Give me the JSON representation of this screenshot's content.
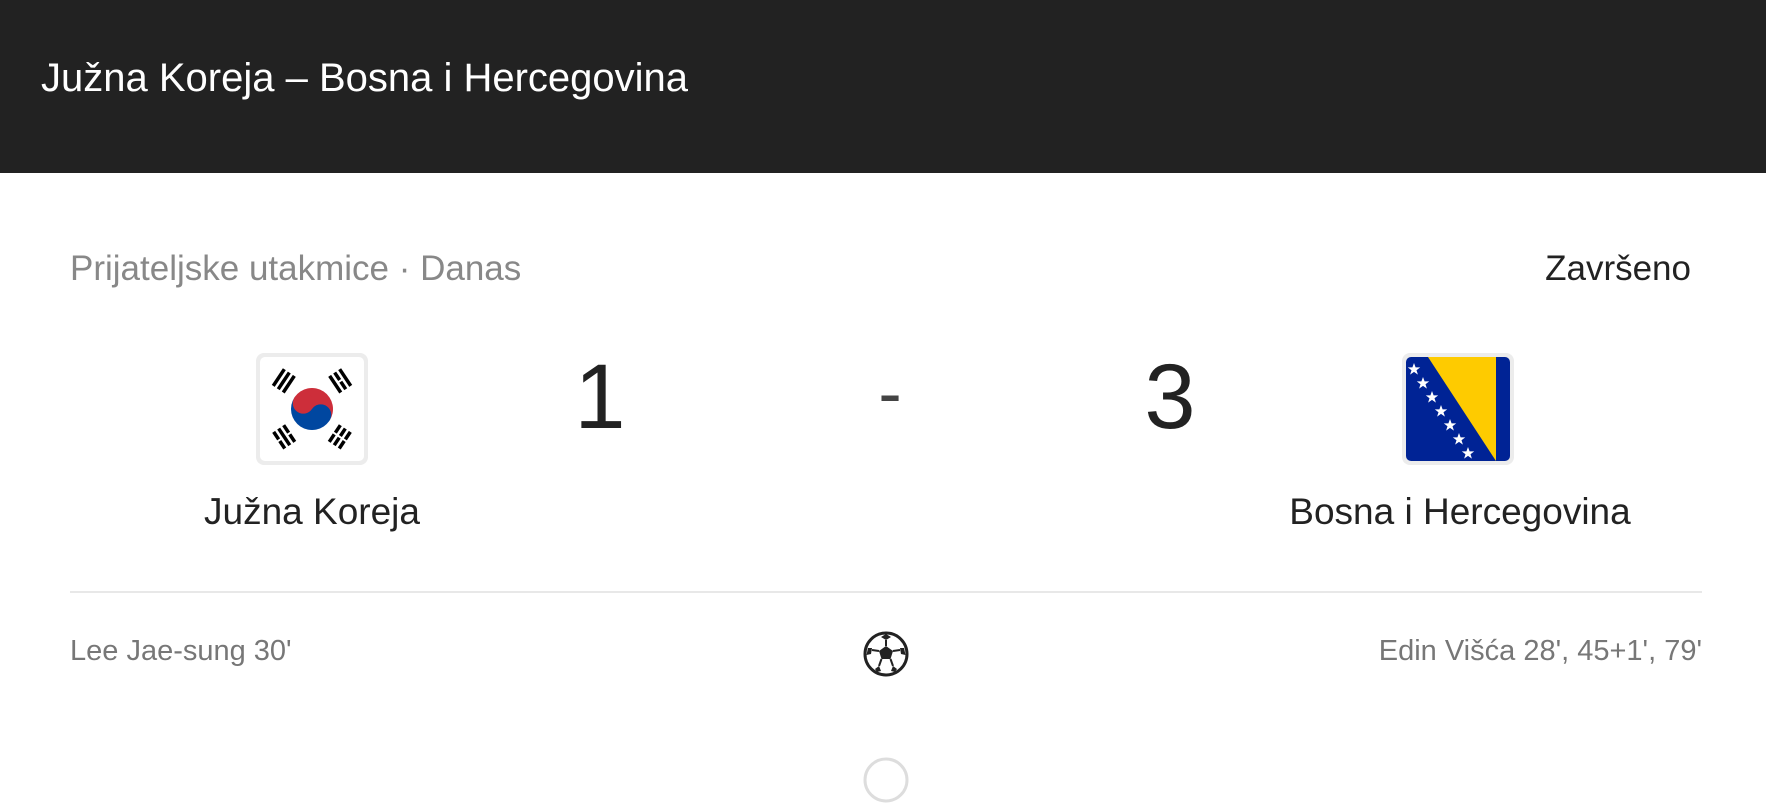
{
  "header": {
    "title": "Južna Koreja – Bosna i Hercegovina"
  },
  "match": {
    "meta": "Prijateljske utakmice · Danas",
    "status": "Završeno",
    "home": {
      "name": "Južna Koreja",
      "score": "1",
      "flag": "south-korea-flag",
      "scorers": "Lee Jae-sung 30'"
    },
    "away": {
      "name": "Bosna i Hercegovina",
      "score": "3",
      "flag": "bosnia-herzegovina-flag",
      "scorers": "Edin Višća 28', 45+1', 79'"
    },
    "separator": "-",
    "goal_icon": "soccer-ball-icon"
  },
  "colors": {
    "header_bg": "#222222",
    "korea_red": "#cd2e3a",
    "korea_blue": "#0047a0",
    "bosnia_blue": "#002395",
    "bosnia_yellow": "#fecb00"
  }
}
